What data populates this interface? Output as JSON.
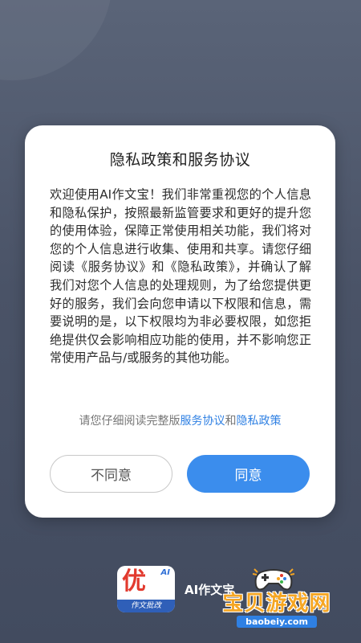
{
  "dialog": {
    "title": "隐私政策和服务协议",
    "body": "欢迎使用AI作文宝！我们非常重视您的个人信息和隐私保护，按照最新监管要求和更好的提升您的使用体验，保障正常使用相关功能，我们将对您的个人信息进行收集、使用和共享。请您仔细阅读《服务协议》和《隐私政策》，并确认了解我们对您个人信息的处理规则，为了给您提供更好的服务，我们会向您申请以下权限和信息，需要说明的是，以下权限均为非必要权限，如您拒绝提供仅会影响相应功能的使用，并不影响您正常使用产品与/或服务的其他功能。",
    "links": {
      "prefix": "请您仔细阅读完整版",
      "service_agreement": "服务协议",
      "conjunction": "和",
      "privacy_policy": "隐私政策"
    },
    "buttons": {
      "disagree": "不同意",
      "agree": "同意"
    }
  },
  "app": {
    "icon_char": "优",
    "icon_badge": "AI",
    "icon_strip": "作文批改",
    "name": "AI作文宝"
  },
  "watermark": {
    "title": "宝贝游戏网",
    "url": "baobeiy.com"
  },
  "colors": {
    "background": "#4f5a6e",
    "accent": "#3b8ded",
    "link": "#2f80e3"
  }
}
